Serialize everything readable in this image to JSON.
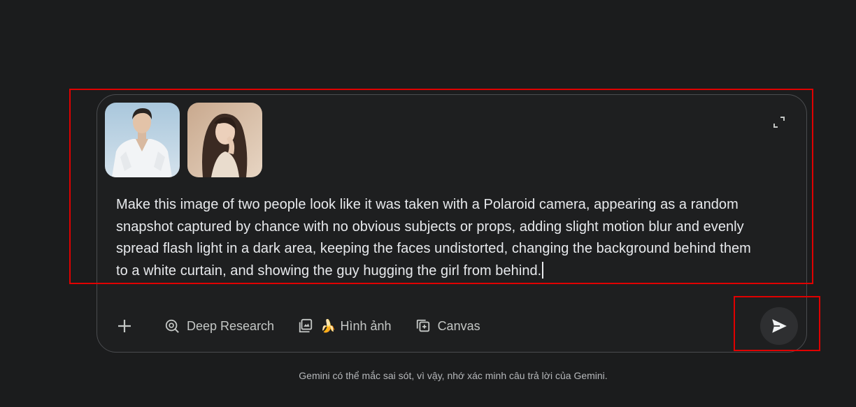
{
  "composer": {
    "attachments": [
      {
        "name": "photo-man",
        "alt": "man in white shirt"
      },
      {
        "name": "photo-woman",
        "alt": "woman with long hair"
      }
    ],
    "prompt_text": "Make this image of two people look like it was taken with a Polaroid camera, appearing as a random snapshot captured by chance with no obvious subjects or props, adding slight motion blur and evenly spread flash light in a dark area, keeping the faces undistorted, changing the background behind them to a white curtain, and showing the guy hugging the girl from behind."
  },
  "toolbar": {
    "plus_icon": "plus-icon",
    "deep_research": {
      "label": "Deep Research",
      "icon": "deep-research-icon"
    },
    "image": {
      "label": "Hình ảnh",
      "icon": "image-gallery-icon",
      "emoji": "🍌"
    },
    "canvas": {
      "label": "Canvas",
      "icon": "canvas-icon"
    }
  },
  "send": {
    "icon": "send-icon"
  },
  "footer": {
    "disclaimer": "Gemini có thể mắc sai sót, vì vậy, nhớ xác minh câu trả lời của Gemini."
  },
  "annotations": {
    "highlight_color": "#e00000"
  },
  "colors": {
    "background": "#1b1c1d",
    "composer_bg": "#1e1f20",
    "composer_border": "#4a4c4f",
    "send_bg": "#2e2f31"
  }
}
